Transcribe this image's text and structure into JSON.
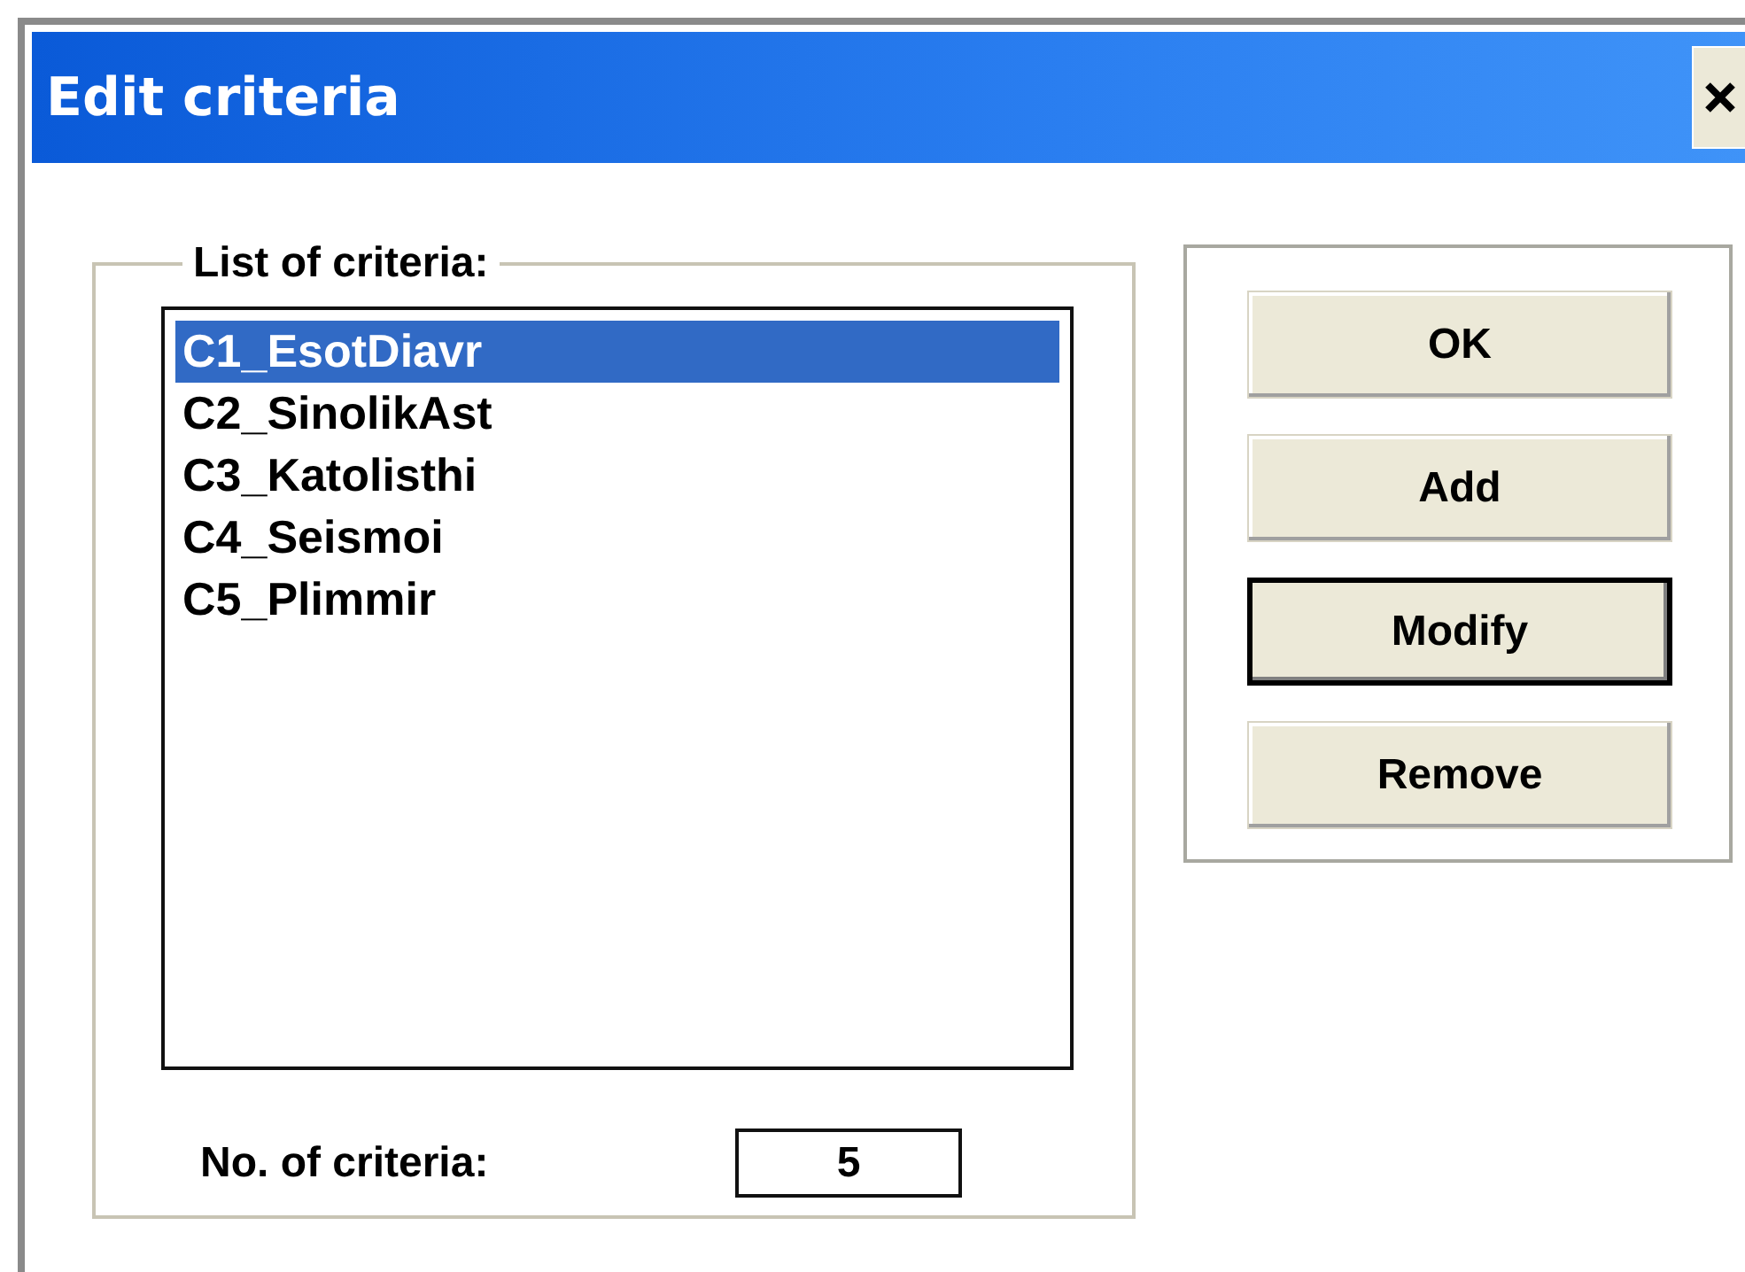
{
  "window": {
    "title": "Edit criteria"
  },
  "criteria_group": {
    "legend": "List of criteria:",
    "items": [
      {
        "label": "C1_EsotDiavr",
        "selected": true
      },
      {
        "label": "C2_SinolikAst",
        "selected": false
      },
      {
        "label": "C3_Katolisthi",
        "selected": false
      },
      {
        "label": "C4_Seismoi",
        "selected": false
      },
      {
        "label": "C5_Plimmir",
        "selected": false
      }
    ],
    "count_label": "No. of criteria:",
    "count_value": "5"
  },
  "buttons": [
    {
      "label": "OK",
      "focused": false
    },
    {
      "label": "Add",
      "focused": false
    },
    {
      "label": "Modify",
      "focused": true
    },
    {
      "label": "Remove",
      "focused": false
    }
  ]
}
